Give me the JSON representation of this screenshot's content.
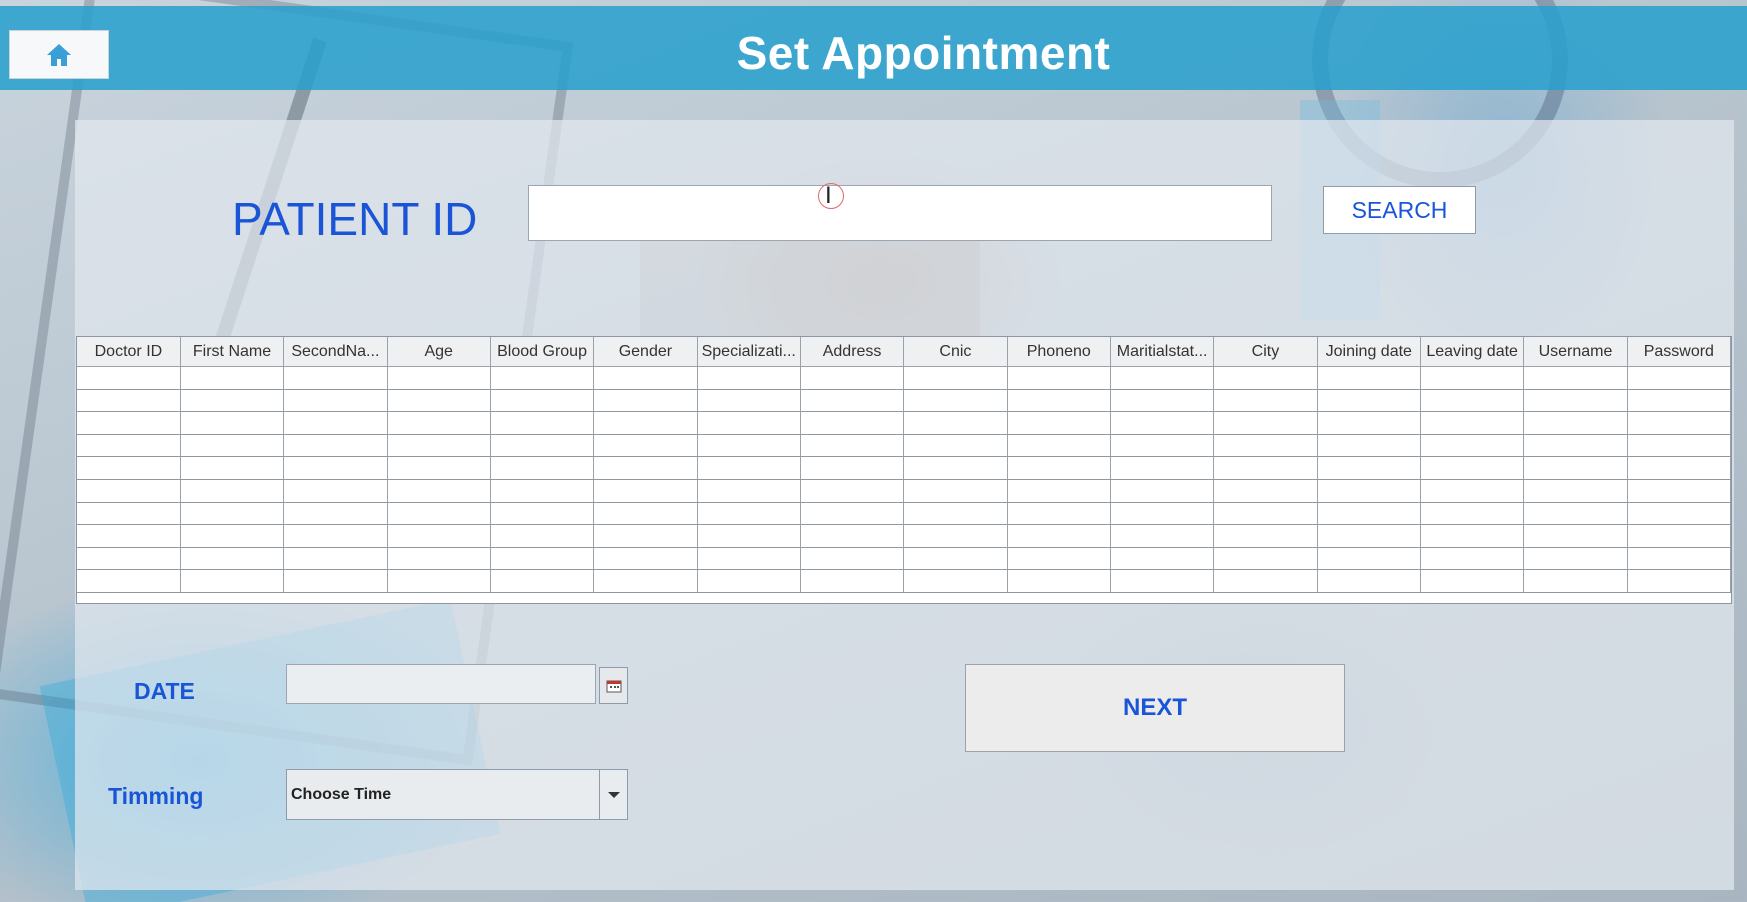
{
  "header": {
    "title": "Set Appointment",
    "home_icon": "home-icon",
    "bar_color": "#28a0cd"
  },
  "search": {
    "label": "PATIENT ID",
    "input_value": "",
    "button_label": "SEARCH",
    "accent_color": "#1a55d8"
  },
  "table": {
    "columns": [
      "Doctor ID",
      "First Name",
      "SecondNa...",
      "Age",
      "Blood Group",
      "Gender",
      "Specializati...",
      "Address",
      "Cnic",
      "Phoneno",
      "Maritialstat...",
      "City",
      "Joining date",
      "Leaving date",
      "Username",
      "Password"
    ],
    "rows": []
  },
  "date": {
    "label": "DATE",
    "value": "",
    "picker_icon": "calendar-icon"
  },
  "timing": {
    "label": "Timming",
    "selected": "Choose Time",
    "arrow_icon": "chevron-down-icon"
  },
  "next": {
    "label": "NEXT"
  }
}
